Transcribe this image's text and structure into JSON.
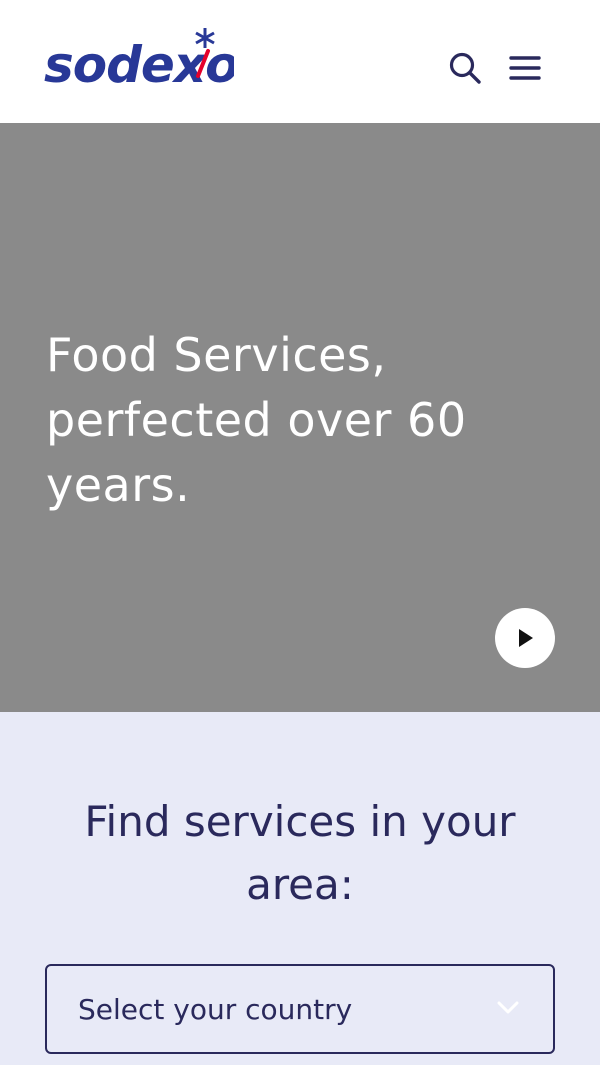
{
  "header": {
    "logo_text": "sodexo",
    "colors": {
      "brand_blue": "#2a295c",
      "brand_red": "#e4002b",
      "logo_blue": "#283897"
    },
    "search_icon": "search-icon",
    "menu_icon": "hamburger-menu-icon"
  },
  "hero": {
    "title": "Food Services, perfected over 60 years.",
    "background_color": "#8a8a8a",
    "play_icon": "play-icon"
  },
  "finder": {
    "title": "Find services in your area:",
    "country_select": {
      "selected_label": "Select your country",
      "icon": "chevron-down-icon"
    },
    "background_color": "#e8eaf7"
  }
}
